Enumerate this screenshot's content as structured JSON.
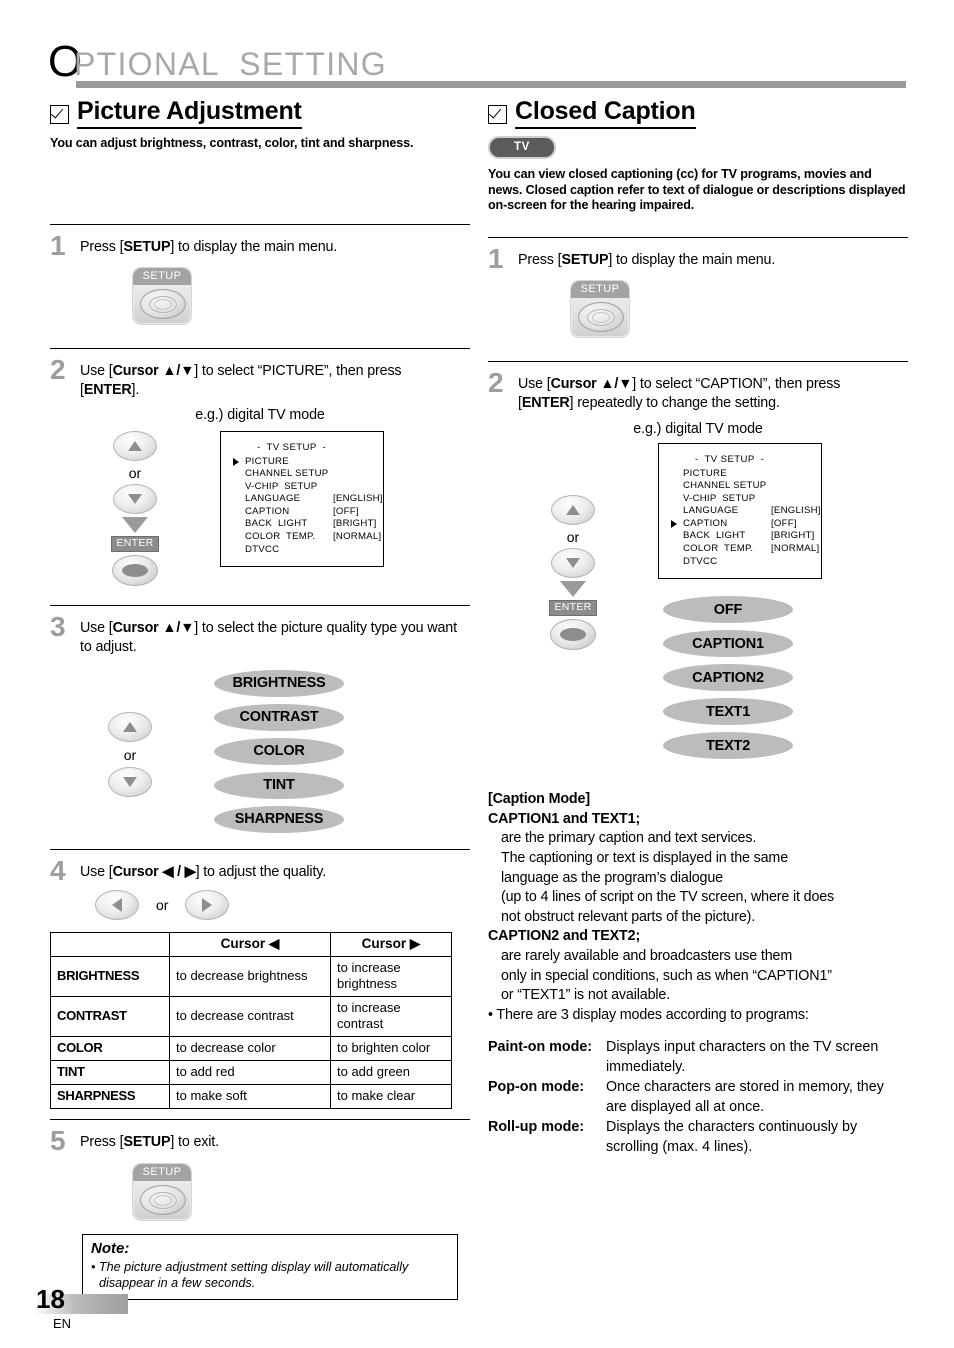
{
  "header": {
    "title_first": "O",
    "title_rest": "PTIONAL  SETTING"
  },
  "left": {
    "section": {
      "title": "Picture Adjustment",
      "desc": "You can adjust brightness, contrast, color, tint and sharpness."
    },
    "steps": [
      {
        "num": "1",
        "text_html": "Press [<b>SETUP</b>] to display the main menu.",
        "text": "Press [SETUP] to display the main menu."
      },
      {
        "num": "2",
        "text": "Use [Cursor ▲/▼] to select “PICTURE”, then press [ENTER].",
        "eg": "e.g.) digital TV mode"
      },
      {
        "num": "3",
        "text": "Use [Cursor ▲/▼] to select the picture quality type you want to adjust."
      },
      {
        "num": "4",
        "text": "Use [Cursor ◀ / ▶] to adjust the quality."
      },
      {
        "num": "5",
        "text": "Press [SETUP] to exit."
      }
    ],
    "osd": {
      "title": "-  TV SETUP  -",
      "cursor_index": 0,
      "rows": [
        {
          "label": "PICTURE",
          "value": ""
        },
        {
          "label": "CHANNEL SETUP",
          "value": ""
        },
        {
          "label": "V-CHIP  SETUP",
          "value": ""
        },
        {
          "label": "LANGUAGE",
          "value": "[ENGLISH]"
        },
        {
          "label": "CAPTION",
          "value": "[OFF]"
        },
        {
          "label": "BACK  LIGHT",
          "value": "[BRIGHT]"
        },
        {
          "label": "COLOR  TEMP.",
          "value": "[NORMAL]"
        },
        {
          "label": "DTVCC",
          "value": ""
        }
      ]
    },
    "quality_pills": [
      "BRIGHTNESS",
      "CONTRAST",
      "COLOR",
      "TINT",
      "SHARPNESS"
    ],
    "table": {
      "headers": [
        "",
        "Cursor ◀",
        "Cursor ▶"
      ],
      "rows": [
        {
          "name": "BRIGHTNESS",
          "left": "to decrease brightness",
          "right": "to increase brightness"
        },
        {
          "name": "CONTRAST",
          "left": "to decrease contrast",
          "right": "to increase contrast"
        },
        {
          "name": "COLOR",
          "left": "to decrease color",
          "right": "to brighten color"
        },
        {
          "name": "TINT",
          "left": "to add red",
          "right": "to add green"
        },
        {
          "name": "SHARPNESS",
          "left": "to make soft",
          "right": "to make clear"
        }
      ]
    },
    "note": {
      "heading": "Note:",
      "body": "• The picture adjustment setting display will automatically disappear in a few seconds."
    },
    "or_label": "or",
    "setup_label": "SETUP",
    "enter_label": "ENTER"
  },
  "right": {
    "section": {
      "title": "Closed Caption",
      "badge": "TV",
      "desc": "You can view closed captioning (cc) for TV programs, movies and news. Closed caption refer to text of dialogue or descriptions displayed on-screen for the hearing impaired."
    },
    "steps": [
      {
        "num": "1",
        "text": "Press [SETUP] to display the main menu."
      },
      {
        "num": "2",
        "text": "Use [Cursor ▲/▼] to select “CAPTION”, then press [ENTER] repeatedly to change the setting.",
        "eg": "e.g.) digital TV mode"
      }
    ],
    "osd": {
      "title": "-  TV SETUP  -",
      "cursor_index": 4,
      "rows": [
        {
          "label": "PICTURE",
          "value": ""
        },
        {
          "label": "CHANNEL SETUP",
          "value": ""
        },
        {
          "label": "V-CHIP  SETUP",
          "value": ""
        },
        {
          "label": "LANGUAGE",
          "value": "[ENGLISH]"
        },
        {
          "label": "CAPTION",
          "value": "[OFF]"
        },
        {
          "label": "BACK  LIGHT",
          "value": "[BRIGHT]"
        },
        {
          "label": "COLOR  TEMP.",
          "value": "[NORMAL]"
        },
        {
          "label": "DTVCC",
          "value": ""
        }
      ]
    },
    "caption_pills": [
      "OFF",
      "CAPTION1",
      "CAPTION2",
      "TEXT1",
      "TEXT2"
    ],
    "caption_mode": {
      "heading": "[Caption Mode]",
      "h1": "CAPTION1 and TEXT1;",
      "p1_lines": [
        "are the primary caption and text services.",
        "The captioning or text is displayed in the same",
        "language as the program’s dialogue",
        "(up to 4 lines of script on the TV screen, where it does",
        "not obstruct relevant parts of the picture)."
      ],
      "h2": "CAPTION2 and TEXT2;",
      "p2_lines": [
        "are rarely available and broadcasters use them",
        "only in special conditions, such as when “CAPTION1”",
        "or “TEXT1” is not available."
      ],
      "bullet": "• There are 3 display modes according to programs:"
    },
    "display_modes": [
      {
        "label": "Paint-on mode:",
        "text": "Displays input characters on the TV screen immediately."
      },
      {
        "label": "Pop-on mode:",
        "text": "Once characters are stored in memory, they are displayed all at once."
      },
      {
        "label": "Roll-up mode:",
        "text": "Displays the characters continuously by scrolling (max. 4 lines)."
      }
    ],
    "or_label": "or",
    "setup_label": "SETUP",
    "enter_label": "ENTER"
  },
  "footer": {
    "page_number": "18",
    "language": "EN"
  }
}
